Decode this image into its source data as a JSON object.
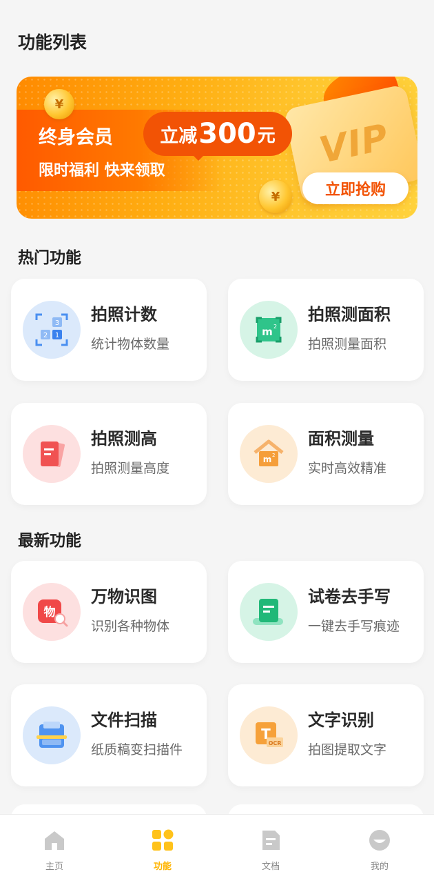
{
  "header": {
    "title": "功能列表"
  },
  "banner": {
    "main_text": "终身会员",
    "pill_lead": "立减",
    "pill_number": "300",
    "pill_unit": "元",
    "sub_text": "限时福利 快来领取",
    "vip_text": "VIP",
    "cta_label": "立即抢购",
    "coin_symbol": "¥",
    "colors": {
      "accent": "#f25305",
      "gold": "#ffc62e"
    }
  },
  "sections": {
    "hot": {
      "title": "热门功能",
      "cards": [
        {
          "title": "拍照计数",
          "desc": "统计物体数量",
          "icon": "count-icon"
        },
        {
          "title": "拍照测面积",
          "desc": "拍照测量面积",
          "icon": "area-photo-icon"
        },
        {
          "title": "拍照测高",
          "desc": "拍照测量高度",
          "icon": "height-icon"
        },
        {
          "title": "面积测量",
          "desc": "实时高效精准",
          "icon": "house-area-icon"
        }
      ]
    },
    "new": {
      "title": "最新功能",
      "cards": [
        {
          "title": "万物识图",
          "desc": "识别各种物体",
          "icon": "object-recognize-icon",
          "icon_text": "物"
        },
        {
          "title": "试卷去手写",
          "desc": "一键去手写痕迹",
          "icon": "paper-erase-icon"
        },
        {
          "title": "文件扫描",
          "desc": "纸质稿变扫描件",
          "icon": "scan-icon"
        },
        {
          "title": "文字识别",
          "desc": "拍图提取文字",
          "icon": "ocr-icon",
          "icon_text": "T",
          "icon_badge": "OCR"
        }
      ]
    }
  },
  "tabbar": {
    "items": [
      {
        "label": "主页",
        "icon": "home-icon",
        "active": false
      },
      {
        "label": "功能",
        "icon": "grid-icon",
        "active": true
      },
      {
        "label": "文档",
        "icon": "document-icon",
        "active": false
      },
      {
        "label": "我的",
        "icon": "profile-icon",
        "active": false
      }
    ],
    "active_color": "#ffb400"
  }
}
